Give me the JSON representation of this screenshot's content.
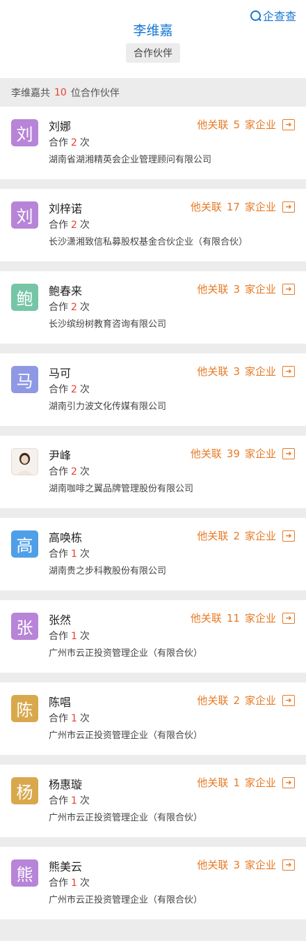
{
  "brand": {
    "name": "企查查"
  },
  "header": {
    "title": "李维嘉",
    "tag": "合作伙伴"
  },
  "summary": {
    "prefix": "李维嘉共",
    "count": "10",
    "suffix": "位合作伙伴"
  },
  "labels": {
    "coop_prefix": "合作",
    "coop_suffix": "次",
    "rel_prefix": "他关联",
    "rel_suffix": "家企业"
  },
  "partners": [
    {
      "avatar_char": "刘",
      "avatar_color": "#b784d8",
      "name": "刘娜",
      "coop_count": "2",
      "rel_count": "5",
      "company": "湖南省湖湘精英会企业管理顾问有限公司"
    },
    {
      "avatar_char": "刘",
      "avatar_color": "#b784d8",
      "name": "刘梓诺",
      "coop_count": "2",
      "rel_count": "17",
      "company": "长沙潇湘致信私募股权基金合伙企业（有限合伙）"
    },
    {
      "avatar_char": "鲍",
      "avatar_color": "#76c5a7",
      "name": "鲍春来",
      "coop_count": "2",
      "rel_count": "3",
      "company": "长沙缤纷树教育咨询有限公司"
    },
    {
      "avatar_char": "马",
      "avatar_color": "#8f98e4",
      "name": "马可",
      "coop_count": "2",
      "rel_count": "3",
      "company": "湖南引力波文化传媒有限公司"
    },
    {
      "avatar_char": "",
      "avatar_color": "#f3ede8",
      "avatar_photo": true,
      "name": "尹峰",
      "coop_count": "2",
      "rel_count": "39",
      "company": "湖南咖啡之翼品牌管理股份有限公司"
    },
    {
      "avatar_char": "高",
      "avatar_color": "#4f9fe8",
      "name": "高唤栋",
      "coop_count": "1",
      "rel_count": "2",
      "company": "湖南贵之步科教股份有限公司"
    },
    {
      "avatar_char": "张",
      "avatar_color": "#b784d8",
      "name": "张然",
      "coop_count": "1",
      "rel_count": "11",
      "company": "广州市云正投资管理企业（有限合伙）"
    },
    {
      "avatar_char": "陈",
      "avatar_color": "#d9a84d",
      "name": "陈唱",
      "coop_count": "1",
      "rel_count": "2",
      "company": "广州市云正投资管理企业（有限合伙）"
    },
    {
      "avatar_char": "杨",
      "avatar_color": "#d9a84d",
      "name": "杨惠璇",
      "coop_count": "1",
      "rel_count": "1",
      "company": "广州市云正投资管理企业（有限合伙）"
    },
    {
      "avatar_char": "熊",
      "avatar_color": "#b784d8",
      "name": "熊美云",
      "coop_count": "1",
      "rel_count": "3",
      "company": "广州市云正投资管理企业（有限合伙）"
    }
  ]
}
